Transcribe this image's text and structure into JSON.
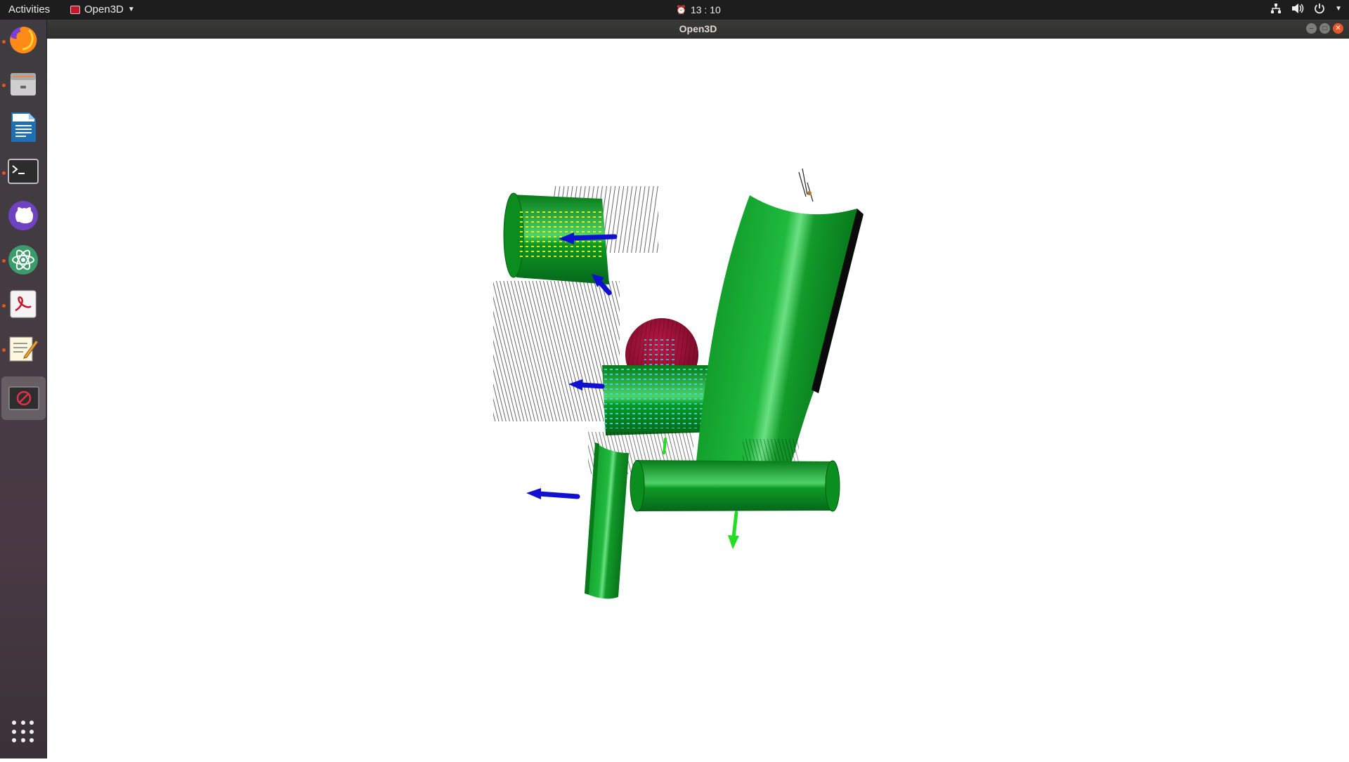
{
  "topbar": {
    "activities": "Activities",
    "app_name": "Open3D",
    "clock": "13 : 10"
  },
  "window": {
    "title": "Open3D"
  },
  "dock": {
    "items": [
      {
        "name": "firefox",
        "running": true
      },
      {
        "name": "files",
        "running": true
      },
      {
        "name": "libreoffice-writer",
        "running": false
      },
      {
        "name": "terminal",
        "running": true
      },
      {
        "name": "github-desktop",
        "running": false
      },
      {
        "name": "atom-editor",
        "running": true
      },
      {
        "name": "document-viewer",
        "running": true
      },
      {
        "name": "text-editor",
        "running": true
      },
      {
        "name": "open3d",
        "running": false,
        "active": true
      }
    ]
  },
  "scene": {
    "description_colors": {
      "mesh": "#0a8a1e",
      "sphere": "#a0103a",
      "arrow_x": "#1010d0",
      "arrow_y": "#22dd22",
      "normals": "#111111",
      "points_yellow": "#f0f020",
      "points_cyan": "#20e0e0"
    }
  },
  "colors": {
    "topbar": "#1d1d1d",
    "accent": "#e95420"
  }
}
